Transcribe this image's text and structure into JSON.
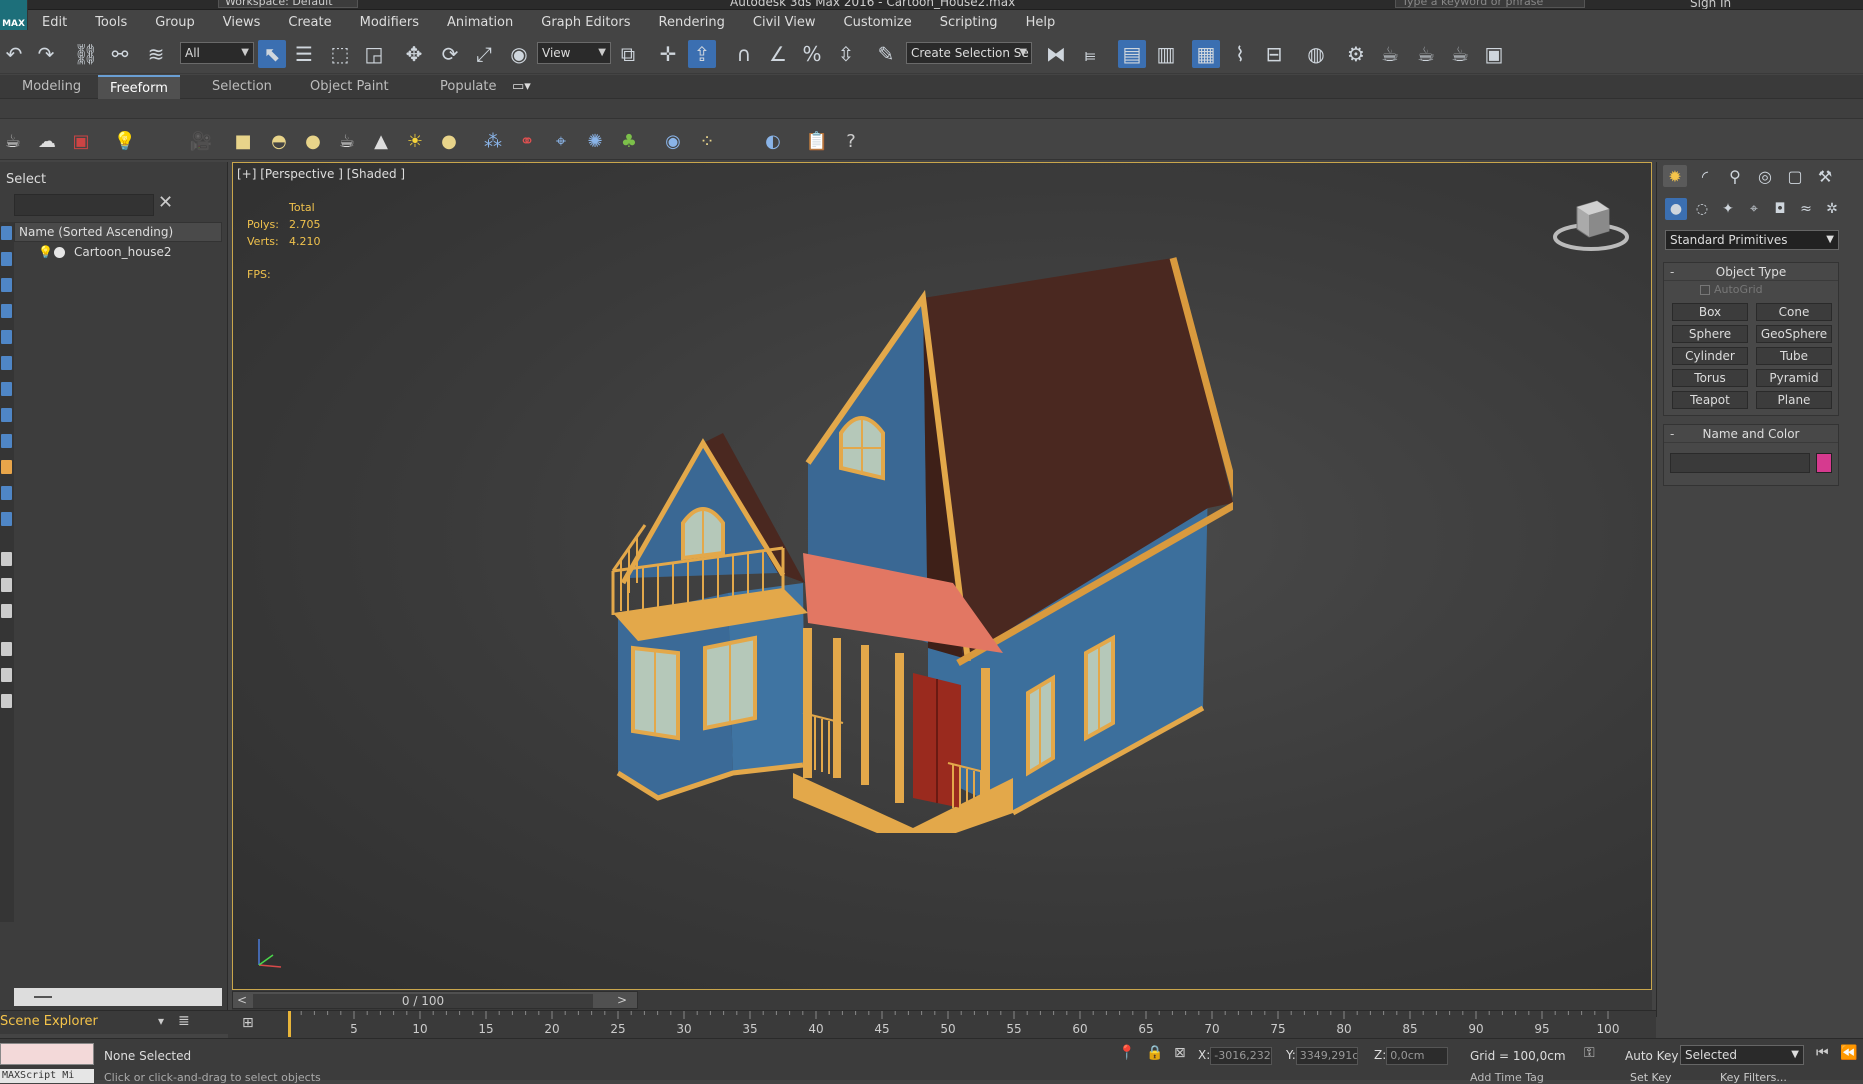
{
  "title_bar": {
    "title": "Autodesk 3ds Max 2016 - Cartoon_House2.max",
    "workspace": "Workspace: Default",
    "search_placeholder": "Type a keyword or phrase",
    "sign_in": "Sign In"
  },
  "logo": {
    "label": "MAX"
  },
  "menu": [
    "Edit",
    "Tools",
    "Group",
    "Views",
    "Create",
    "Modifiers",
    "Animation",
    "Graph Editors",
    "Rendering",
    "Civil View",
    "Customize",
    "Scripting",
    "Help"
  ],
  "toolbar": {
    "selection_filter": "All",
    "reference_coord": "View",
    "named_selection_placeholder": "Create Selection Se"
  },
  "ribbon_tabs": [
    "Modeling",
    "Freeform",
    "Selection",
    "Object Paint",
    "Populate"
  ],
  "scene_explorer": {
    "select_label": "Select",
    "column_header": "Name (Sorted Ascending)",
    "items": [
      "Cartoon_house2"
    ],
    "footer_label": "Scene Explorer"
  },
  "viewport": {
    "label": "[+] [Perspective ] [Shaded ]",
    "stats_header": "Total",
    "polys_label": "Polys:",
    "polys_value": "2.705",
    "verts_label": "Verts:",
    "verts_value": "4.210",
    "fps_label": "FPS:"
  },
  "command_panel": {
    "category": "Standard Primitives",
    "object_type_header": "Object Type",
    "autogrid_label": "AutoGrid",
    "buttons": [
      "Box",
      "Cone",
      "Sphere",
      "GeoSphere",
      "Cylinder",
      "Tube",
      "Torus",
      "Pyramid",
      "Teapot",
      "Plane"
    ],
    "name_color_header": "Name and Color",
    "object_color": "#d63a8f"
  },
  "time_slider": {
    "frame": "0 / 100",
    "prev": "<",
    "next": ">"
  },
  "track_ticks": [
    "5",
    "10",
    "15",
    "20",
    "25",
    "30",
    "35",
    "40",
    "45",
    "50",
    "55",
    "60",
    "65",
    "70",
    "75",
    "80",
    "85",
    "90",
    "95",
    "100"
  ],
  "status": {
    "selection": "None Selected",
    "hint": "Click or click-and-drag to select objects",
    "maxscript": "MAXScript Mi",
    "x_label": "X:",
    "x_value": "-3016,232c",
    "y_label": "Y:",
    "y_value": "3349,291c",
    "z_label": "Z:",
    "z_value": "0,0cm",
    "grid": "Grid = 100,0cm",
    "auto_key": "Auto Key",
    "auto_key_mode": "Selected",
    "set_key": "Set Key",
    "key_filters": "Key Filters...",
    "add_time_tag": "Add Time Tag"
  },
  "colors": {
    "accent": "#3b6fb1",
    "viewport_border": "#c9a64c",
    "stats_text": "#f0c24d",
    "house_wall": "#3c6f9c",
    "house_trim": "#e3a84a",
    "house_roof": "#4a2820",
    "porch_roof": "#e27763",
    "door": "#9a2a1e"
  }
}
